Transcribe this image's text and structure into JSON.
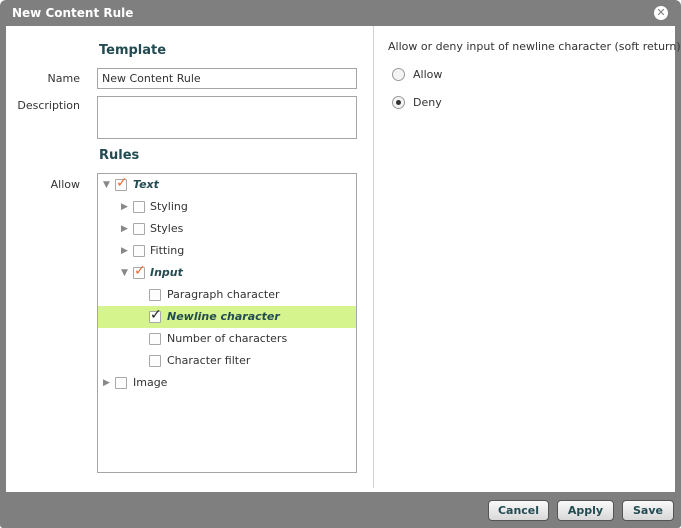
{
  "dialog": {
    "title": "New Content Rule",
    "close_symbol": "✕"
  },
  "template": {
    "section_title": "Template",
    "name_label": "Name",
    "name_value": "New Content Rule",
    "description_label": "Description",
    "description_value": ""
  },
  "rules": {
    "section_title": "Rules",
    "allow_label": "Allow",
    "tree": [
      {
        "label": "Text",
        "checked": true,
        "arrow": "expanded"
      },
      {
        "label": "Styling",
        "checked": false,
        "arrow": "collapsed"
      },
      {
        "label": "Styles",
        "checked": false,
        "arrow": "collapsed"
      },
      {
        "label": "Fitting",
        "checked": false,
        "arrow": "collapsed"
      },
      {
        "label": "Input",
        "checked": true,
        "arrow": "expanded"
      },
      {
        "label": "Paragraph character",
        "checked": false,
        "arrow": "none"
      },
      {
        "label": "Newline character",
        "checked": true,
        "arrow": "none",
        "selected": true
      },
      {
        "label": "Number of characters",
        "checked": false,
        "arrow": "none"
      },
      {
        "label": "Character filter",
        "checked": false,
        "arrow": "none"
      },
      {
        "label": "Image",
        "checked": false,
        "arrow": "collapsed"
      }
    ]
  },
  "right_panel": {
    "label": "Allow or deny input of newline character (soft return)",
    "options": [
      {
        "label": "Allow",
        "selected": false
      },
      {
        "label": "Deny",
        "selected": true
      }
    ]
  },
  "footer": {
    "cancel_label": "Cancel",
    "apply_label": "Apply",
    "save_label": "Save"
  },
  "colors": {
    "title_bar": "#7f7f7f",
    "heading_text": "#234b52",
    "selected_row": "#d6f48d",
    "checkmark_parent": "#f06a34"
  }
}
